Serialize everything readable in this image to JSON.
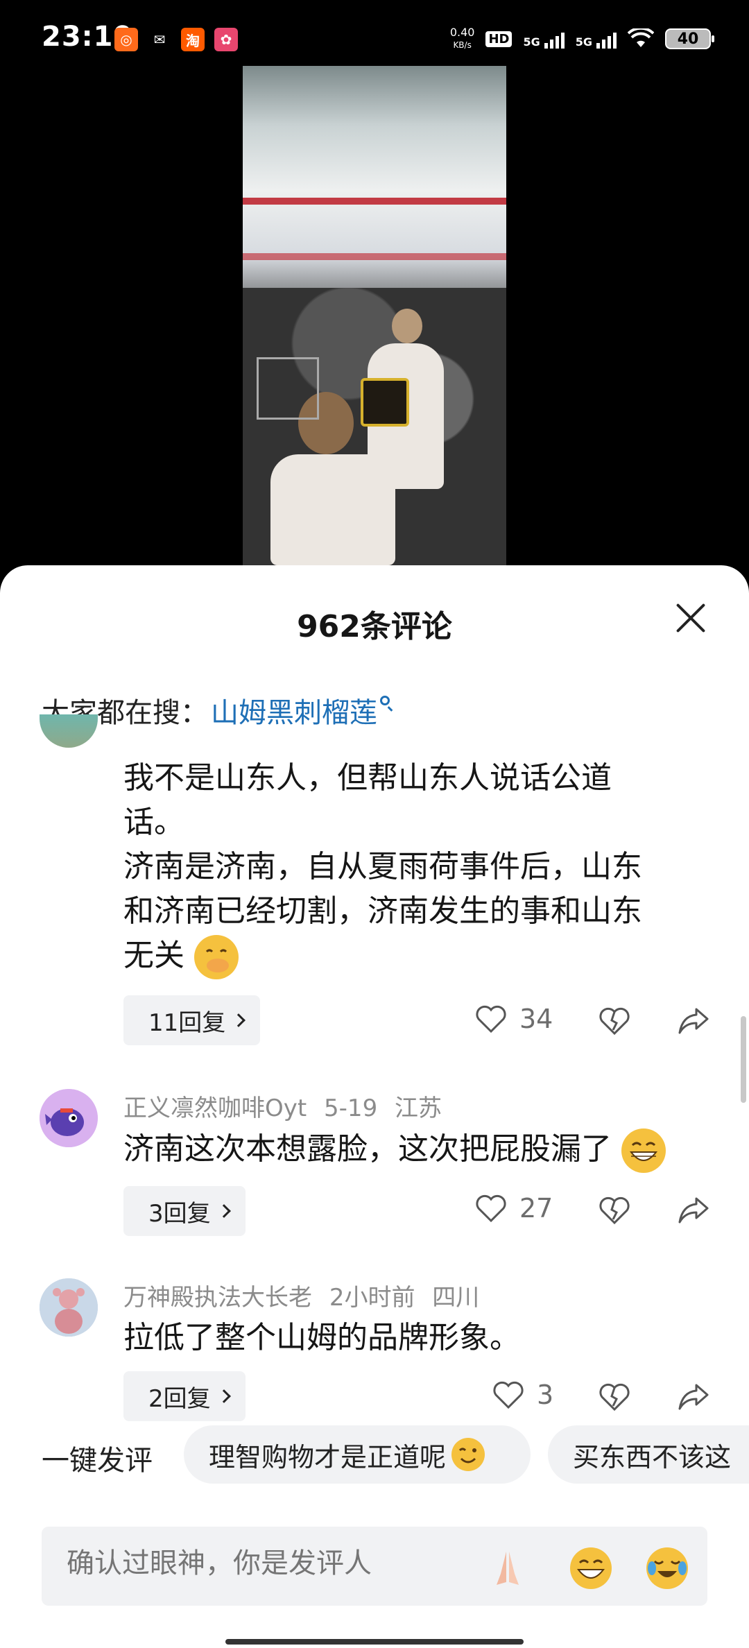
{
  "status_bar": {
    "time": "23:19",
    "net_speed_value": "0.40",
    "net_speed_unit": "KB/s",
    "network_5g_1": "5G",
    "network_5g_2": "5G",
    "battery": "40",
    "app_icons": [
      "kuaishou-icon",
      "wechat-icon",
      "taobao-icon",
      "lofter-icon"
    ]
  },
  "video": {
    "description_icon": "video-frame"
  },
  "comments_sheet": {
    "title": "962条评论",
    "hot_search_label": "大家都在搜：",
    "hot_search_link": "山姆黑刺榴莲",
    "comments": [
      {
        "text_line1": "我不是山东人，但帮山东人说话公道",
        "text_line2": "话。",
        "text_line3": "济南是济南，自从夏雨荷事件后，山东",
        "text_line4": "和济南已经切割，济南发生的事和山东",
        "text_line5": "无关",
        "replies_label": "11回复",
        "likes": "34"
      },
      {
        "username": "正义凛然咖啡Oyt",
        "date": "5-19",
        "location": "江苏",
        "text": "济南这次本想露脸，这次把屁股漏了",
        "replies_label": "3回复",
        "likes": "27"
      },
      {
        "username": "万神殿执法大长老",
        "date": "2小时前",
        "location": "四川",
        "text": "拉低了整个山姆的品牌形象。",
        "replies_label": "2回复",
        "likes": "3"
      }
    ],
    "quick_reply_label": "一键发评",
    "quick_chips": [
      "理智购物才是正道呢",
      "买东西不该这"
    ],
    "input_placeholder": "确认过眼神，你是发评人"
  },
  "colors": {
    "accent_link": "#1e6fb6",
    "sheet_bg": "#ffffff",
    "chip_bg": "#f1f2f4"
  }
}
